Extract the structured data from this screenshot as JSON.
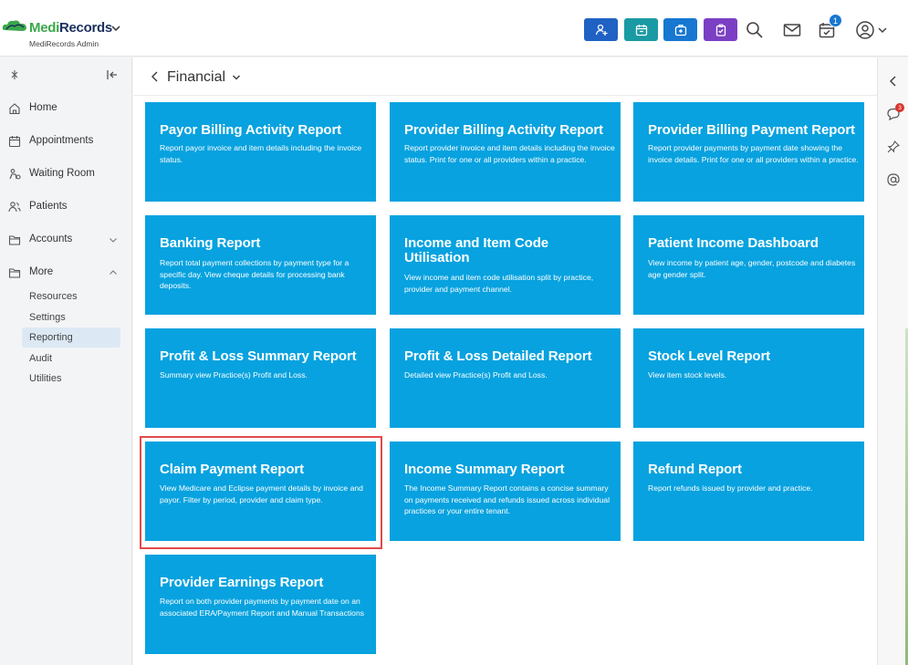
{
  "header": {
    "brand_part1": "Medi",
    "brand_part2": "Records",
    "brand_sub": "MediRecords Admin",
    "notification_count": "1",
    "icons": [
      "add-patient-icon",
      "calendar-icon",
      "medical-kit-icon",
      "clipboard-icon",
      "search-icon",
      "mail-icon",
      "tasks-icon",
      "user-account-icon"
    ],
    "colors": {
      "add_patient": "#1f62c4",
      "calendar": "#1a9aa3",
      "medical_kit": "#1777d1",
      "clipboard": "#7b3fc4"
    }
  },
  "sidebar": {
    "items": [
      {
        "label": "Home",
        "icon": "home-icon"
      },
      {
        "label": "Appointments",
        "icon": "calendar-icon"
      },
      {
        "label": "Waiting Room",
        "icon": "waiting-room-icon"
      },
      {
        "label": "Patients",
        "icon": "patients-icon"
      },
      {
        "label": "Accounts",
        "icon": "folder-icon"
      },
      {
        "label": "More",
        "icon": "folder-icon"
      }
    ],
    "sub_items": [
      {
        "label": "Resources"
      },
      {
        "label": "Settings"
      },
      {
        "label": "Reporting",
        "active": true
      },
      {
        "label": "Audit"
      },
      {
        "label": "Utilities"
      }
    ]
  },
  "main": {
    "title": "Financial",
    "cards": [
      {
        "title": "Payor Billing Activity Report",
        "desc": "Report payor invoice and item details including the invoice status."
      },
      {
        "title": "Provider Billing Activity Report",
        "desc": "Report provider invoice and item details including the invoice status. Print for one or all providers within a practice."
      },
      {
        "title": "Provider Billing Payment Report",
        "desc": "Report provider payments by payment date showing the invoice details. Print for one or all providers within a practice."
      },
      {
        "title": "Banking Report",
        "desc": "Report total payment collections by payment type for a specific day. View cheque details for processing bank deposits."
      },
      {
        "title": "Income and Item Code Utilisation",
        "desc": "View income and item code utilisation split by practice, provider and payment channel."
      },
      {
        "title": "Patient Income Dashboard",
        "desc": "View income by patient age, gender, postcode and diabetes age gender split."
      },
      {
        "title": "Profit & Loss Summary Report",
        "desc": "Summary view Practice(s) Profit and Loss."
      },
      {
        "title": "Profit & Loss Detailed Report",
        "desc": "Detailed view Practice(s) Profit and Loss."
      },
      {
        "title": "Stock Level Report",
        "desc": "View item stock levels."
      },
      {
        "title": "Claim Payment Report",
        "desc": "View Medicare and Eclipse payment details by invoice and payor. Filter by period, provider and claim type."
      },
      {
        "title": "Income Summary Report",
        "desc": "The Income Summary Report contains a concise summary on payments received and refunds issued across individual practices or your entire tenant."
      },
      {
        "title": "Refund Report",
        "desc": "Report refunds issued by provider and practice."
      },
      {
        "title": "Provider Earnings Report",
        "desc": "Report on both provider payments by payment date on an associated ERA/Payment Report and Manual Transactions"
      }
    ]
  },
  "right_rail": {
    "comment_badge": "3",
    "icons": [
      "collapse-left-icon",
      "comment-icon",
      "pin-icon",
      "at-sign-icon"
    ]
  }
}
